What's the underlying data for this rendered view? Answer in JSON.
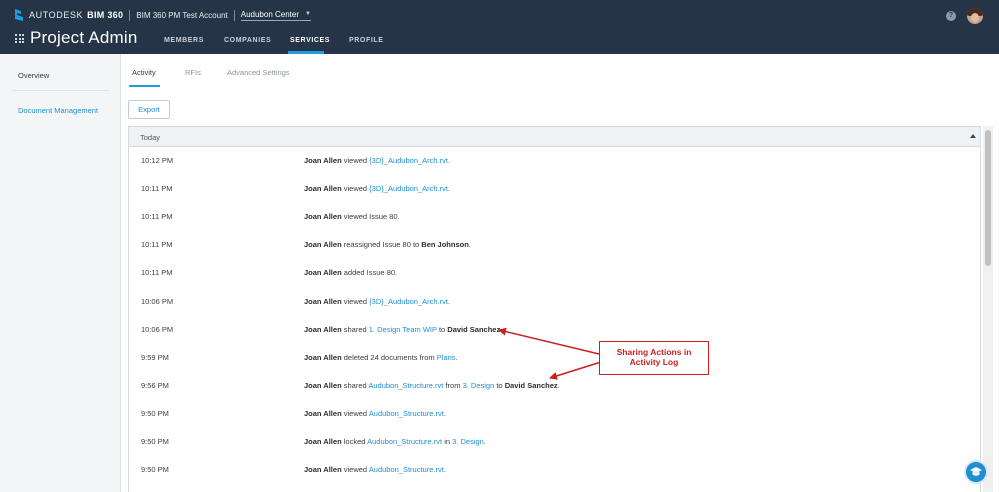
{
  "header": {
    "brand_autodesk": "AUTODESK",
    "brand_product": "BIM 360",
    "account": "BIM 360 PM Test Account",
    "project": "Audubon Center",
    "app_title": "Project Admin",
    "nav": [
      {
        "label": "MEMBERS",
        "active": false
      },
      {
        "label": "COMPANIES",
        "active": false
      },
      {
        "label": "SERVICES",
        "active": true
      },
      {
        "label": "PROFILE",
        "active": false
      }
    ],
    "help_icon": "?"
  },
  "sidebar": {
    "items": [
      {
        "label": "Overview"
      },
      {
        "label": "Document Management"
      }
    ]
  },
  "tabs": [
    {
      "label": "Activity",
      "active": true
    },
    {
      "label": "RFIs",
      "active": false
    },
    {
      "label": "Advanced Settings",
      "active": false
    }
  ],
  "export_label": "Export",
  "activity": {
    "group_label": "Today",
    "rows": [
      {
        "time": "10:12 PM",
        "parts": [
          {
            "t": "Joan Allen",
            "s": "b"
          },
          {
            "t": " viewed "
          },
          {
            "t": "{3D}_Audubon_Arch.rvt",
            "s": "l"
          },
          {
            "t": "."
          }
        ]
      },
      {
        "time": "10:11 PM",
        "parts": [
          {
            "t": "Joan Allen",
            "s": "b"
          },
          {
            "t": " viewed "
          },
          {
            "t": "{3D}_Audubon_Arch.rvt",
            "s": "l"
          },
          {
            "t": "."
          }
        ]
      },
      {
        "time": "10:11 PM",
        "parts": [
          {
            "t": "Joan Allen",
            "s": "b"
          },
          {
            "t": " viewed Issue 80."
          }
        ]
      },
      {
        "time": "10:11 PM",
        "parts": [
          {
            "t": "Joan Allen",
            "s": "b"
          },
          {
            "t": " reassigned Issue 80 to "
          },
          {
            "t": "Ben Johnson",
            "s": "b"
          },
          {
            "t": "."
          }
        ]
      },
      {
        "time": "10:11 PM",
        "parts": [
          {
            "t": "Joan Allen",
            "s": "b"
          },
          {
            "t": " added Issue 80."
          }
        ]
      },
      {
        "time": "10:06 PM",
        "parts": [
          {
            "t": "Joan Allen",
            "s": "b"
          },
          {
            "t": " viewed "
          },
          {
            "t": "{3D}_Audubon_Arch.rvt",
            "s": "l"
          },
          {
            "t": "."
          }
        ]
      },
      {
        "time": "10:06 PM",
        "parts": [
          {
            "t": "Joan Allen",
            "s": "b"
          },
          {
            "t": " shared "
          },
          {
            "t": "1. Design Team WIP",
            "s": "l"
          },
          {
            "t": " to "
          },
          {
            "t": "David Sanchez",
            "s": "b"
          },
          {
            "t": "."
          }
        ]
      },
      {
        "time": "9:59 PM",
        "parts": [
          {
            "t": "Joan Allen",
            "s": "b"
          },
          {
            "t": " deleted 24 documents from "
          },
          {
            "t": "Plans",
            "s": "l"
          },
          {
            "t": "."
          }
        ]
      },
      {
        "time": "9:56 PM",
        "parts": [
          {
            "t": "Joan Allen",
            "s": "b"
          },
          {
            "t": " shared "
          },
          {
            "t": "Audubon_Structure.rvt",
            "s": "l"
          },
          {
            "t": " from "
          },
          {
            "t": "3. Design",
            "s": "l"
          },
          {
            "t": " to "
          },
          {
            "t": "David Sanchez",
            "s": "b"
          },
          {
            "t": "."
          }
        ]
      },
      {
        "time": "9:50 PM",
        "parts": [
          {
            "t": "Joan Allen",
            "s": "b"
          },
          {
            "t": " viewed "
          },
          {
            "t": "Audubon_Structure.rvt",
            "s": "l"
          },
          {
            "t": "."
          }
        ]
      },
      {
        "time": "9:50 PM",
        "parts": [
          {
            "t": "Joan Allen",
            "s": "b"
          },
          {
            "t": " locked "
          },
          {
            "t": "Audubon_Structure.rvt",
            "s": "l"
          },
          {
            "t": " in "
          },
          {
            "t": "3. Design",
            "s": "l"
          },
          {
            "t": "."
          }
        ]
      },
      {
        "time": "9:50 PM",
        "parts": [
          {
            "t": "Joan Allen",
            "s": "b"
          },
          {
            "t": " viewed "
          },
          {
            "t": "Audubon_Structure.rvt",
            "s": "l"
          },
          {
            "t": "."
          }
        ]
      }
    ]
  },
  "callout": {
    "line1": "Sharing Actions in",
    "line2": "Activity Log",
    "color": "#cc1f1f"
  },
  "colors": {
    "header_bg": "#253446",
    "accent": "#1f9be4",
    "link": "#1f8fd1"
  }
}
